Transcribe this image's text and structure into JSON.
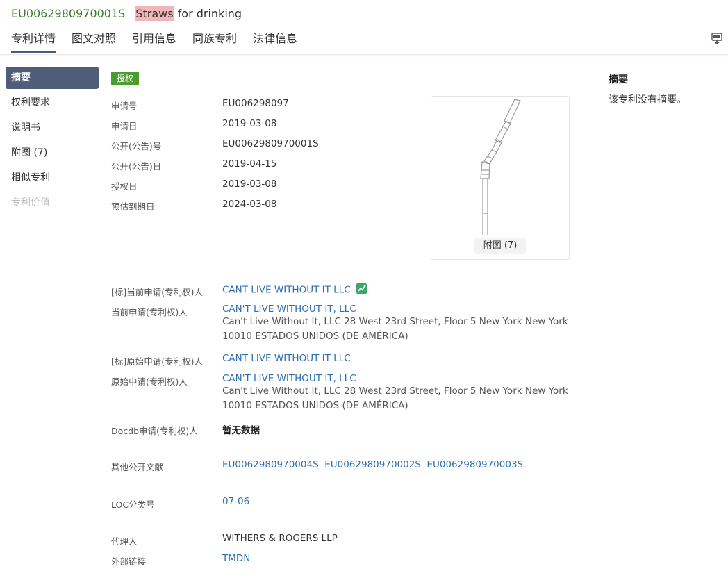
{
  "header": {
    "patent_number": "EU0062980970001S",
    "title_highlight": "Straws",
    "title_rest": "for drinking"
  },
  "tabs": [
    {
      "label": "专利详情",
      "active": true
    },
    {
      "label": "图文对照"
    },
    {
      "label": "引用信息"
    },
    {
      "label": "同族专利"
    },
    {
      "label": "法律信息"
    }
  ],
  "sidebar": {
    "items": [
      {
        "label": "摘要",
        "state": "active"
      },
      {
        "label": "权利要求"
      },
      {
        "label": "说明书"
      },
      {
        "label": "附图 (7)"
      },
      {
        "label": "相似专利"
      },
      {
        "label": "专利价值",
        "state": "disabled"
      }
    ]
  },
  "status_badge": "授权",
  "fields": {
    "application_no": {
      "label": "申请号",
      "value": "EU006298097"
    },
    "application_date": {
      "label": "申请日",
      "value": "2019-03-08"
    },
    "publication_no": {
      "label": "公开(公告)号",
      "value": "EU0062980970001S"
    },
    "publication_date": {
      "label": "公开(公告)日",
      "value": "2019-04-15"
    },
    "grant_date": {
      "label": "授权日",
      "value": "2019-03-08"
    },
    "expiry_date": {
      "label": "预估到期日",
      "value": "2024-03-08"
    },
    "std_current_applicant": {
      "label": "[标]当前申请(专利权)人",
      "value": "CANT LIVE WITHOUT IT LLC"
    },
    "current_applicant": {
      "label": "当前申请(专利权)人",
      "value": "CAN'T LIVE WITHOUT IT, LLC",
      "address_line1": "Can't Live Without It, LLC 28 West 23rd Street, Floor 5 New York New York",
      "address_line2": "10010 ESTADOS UNIDOS (DE AMÉRICA)"
    },
    "std_original_applicant": {
      "label": "[标]原始申请(专利权)人",
      "value": "CANT LIVE WITHOUT IT LLC"
    },
    "original_applicant": {
      "label": "原始申请(专利权)人",
      "value": "CAN'T LIVE WITHOUT IT, LLC",
      "address_line1": "Can't Live Without It, LLC 28 West 23rd Street, Floor 5 New York New York",
      "address_line2": "10010 ESTADOS UNIDOS (DE AMÉRICA)"
    },
    "docdb_applicant": {
      "label": "Docdb申请(专利权)人",
      "value": "暂无数据"
    },
    "other_publications": {
      "label": "其他公开文献",
      "values": [
        "EU0062980970004S",
        "EU0062980970002S",
        "EU0062980970003S"
      ]
    },
    "loc_class": {
      "label": "LOC分类号",
      "value": "07-06"
    },
    "agent": {
      "label": "代理人",
      "value": "WITHERS & ROGERS LLP"
    },
    "external_link": {
      "label": "外部链接",
      "value": "TMDN"
    }
  },
  "image_card": {
    "caption": "附图 (7)"
  },
  "abstract": {
    "title": "摘要",
    "text": "该专利没有摘要。"
  },
  "colors": {
    "patent_number": "#3a7a28",
    "highlight": "#f2b6b8",
    "link": "#2e6fb0",
    "nav_active_bg": "#4f5d78",
    "badge_bg": "#4a9c2e"
  }
}
